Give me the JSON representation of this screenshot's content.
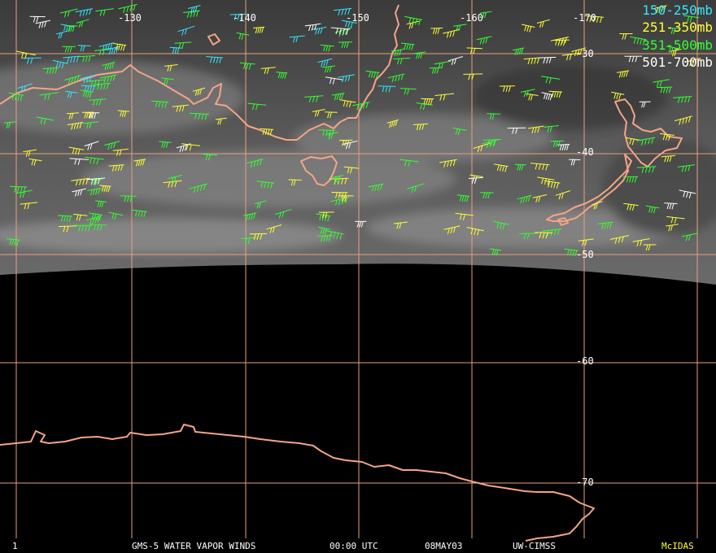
{
  "map": {
    "longitude_labels": [
      "-130",
      "-140",
      "-150",
      "-160",
      "-170"
    ],
    "latitude_labels": [
      "-30",
      "-40",
      "-50",
      "-60",
      "-70"
    ],
    "colors": {
      "grid": "#e8a07e",
      "coast": "#f4a487",
      "cloud_image": "#4a4a4a",
      "background": "#000000"
    }
  },
  "legend": [
    {
      "label": "150-250mb",
      "color": "#33e6ff"
    },
    {
      "label": "251-350mb",
      "color": "#ffff33"
    },
    {
      "label": "351-500mb",
      "color": "#33ff33"
    },
    {
      "label": "501-700mb",
      "color": "#ffffff"
    }
  ],
  "footer": {
    "frame": "1",
    "title": "GMS-5 WATER VAPOR WINDS",
    "time": "00:00 UTC",
    "date": "08MAY03",
    "source": "UW-CIMSS",
    "system": "McIDAS",
    "system_color": "#ffff33"
  }
}
